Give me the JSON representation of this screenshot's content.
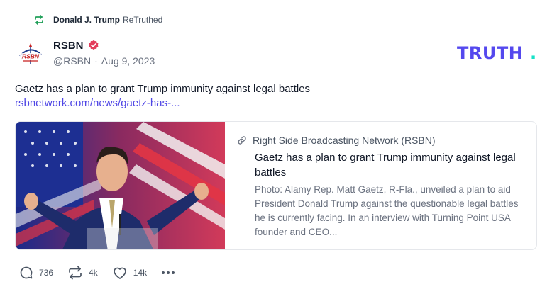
{
  "retruth": {
    "icon": "retruth-icon",
    "name": "Donald J. Trump",
    "label": "ReTruthed"
  },
  "author": {
    "display_name": "RSBN",
    "handle": "@RSBN",
    "separator": "·",
    "date": "Aug 9, 2023",
    "avatar_text": "RSBN",
    "verified_icon": "verified-badge-icon"
  },
  "brand": {
    "logo_text": "TRUTH",
    "logo_dot": ".",
    "primary_color": "#5448ee",
    "accent_color": "#17e2c7"
  },
  "post": {
    "text": "Gaetz has a plan to grant Trump immunity against legal battles",
    "link_text": "rsbnetwork.com/news/gaetz-has-..."
  },
  "card": {
    "source": "Right Side Broadcasting Network (RSBN)",
    "title": "Gaetz has a plan to grant Trump immunity against legal battles",
    "description": "Photo: Alamy Rep. Matt Gaetz, R-Fla., unveiled a plan to aid President Donald Trump against the questionable legal battles he is currently facing. In an interview with Turning Point USA founder and CEO..."
  },
  "actions": {
    "replies": "736",
    "retruths": "4k",
    "likes": "14k"
  }
}
